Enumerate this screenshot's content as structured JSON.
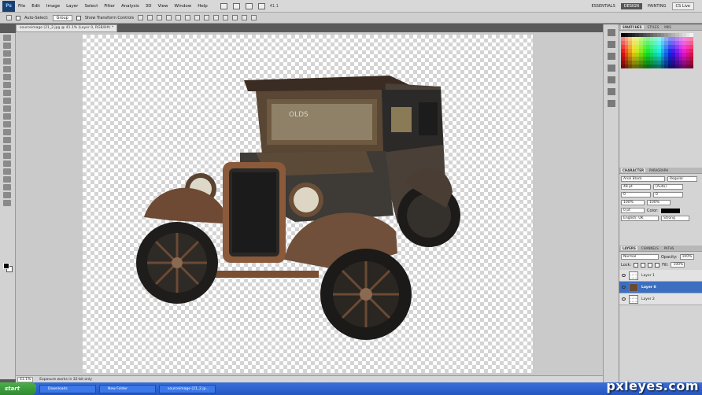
{
  "menubar": {
    "logo": "Ps",
    "items": [
      "File",
      "Edit",
      "Image",
      "Layer",
      "Select",
      "Filter",
      "Analysis",
      "3D",
      "View",
      "Window",
      "Help"
    ],
    "zoom": "41.1",
    "workspaces": [
      "ESSENTIALS",
      "DESIGN",
      "PAINTING"
    ],
    "cs_live": "CS Live"
  },
  "options": {
    "auto_select_label": "Auto-Select:",
    "auto_select_value": "Group",
    "show_transform_label": "Show Transform Controls"
  },
  "document": {
    "tab_title": "sourceimage (21_2.jpg @ 41.1% (Layer 0, RGB/8#) *",
    "zoom": "41.1%",
    "status_text": "Exposure works in 32-bit only"
  },
  "panels": {
    "swatch_tabs": [
      "SWATCHES",
      "STYLES",
      "MKS"
    ],
    "char_tabs": [
      "CHARACTER",
      "PARAGRAPH"
    ],
    "font_family": "Arial Black",
    "font_style": "Regular",
    "font_size": "48 pt",
    "leading": "(Auto)",
    "kerning": "0",
    "scale_v": "100%",
    "scale_h": "100%",
    "baseline": "0 pt",
    "color_label": "Color:",
    "language": "English: UK",
    "antialias": "Strong",
    "layer_tabs": [
      "LAYERS",
      "CHANNELS",
      "PATHS"
    ],
    "blend_mode": "Normal",
    "opacity_label": "Opacity:",
    "opacity": "100%",
    "lock_label": "Lock:",
    "fill_label": "Fill:",
    "fill": "100%",
    "layers": [
      {
        "name": "Layer 1",
        "active": false
      },
      {
        "name": "Layer 0",
        "active": true
      },
      {
        "name": "Layer 2",
        "active": false
      }
    ]
  },
  "taskbar": {
    "start": "start",
    "items": [
      "Downloads",
      "New Folder",
      "sourceimage (21_2.jp..."
    ]
  },
  "watermark": "pxleyes.com",
  "car_sign": "OLDS"
}
